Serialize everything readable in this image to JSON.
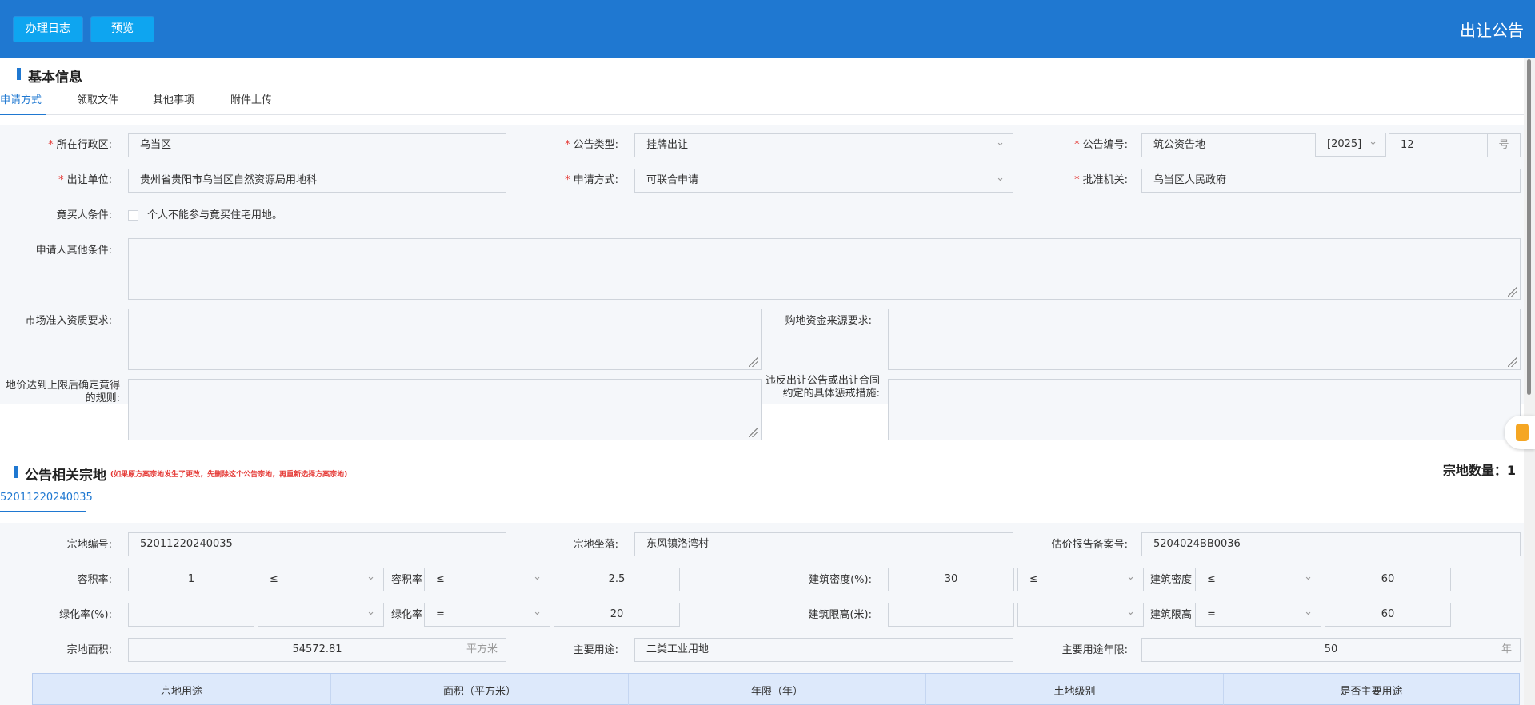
{
  "header": {
    "log_button": "办理日志",
    "preview_button": "预览",
    "title": "出让公告"
  },
  "basic": {
    "title": "基本信息",
    "tabs": [
      "申请方式",
      "领取文件",
      "其他事项",
      "附件上传"
    ],
    "fields": {
      "region_label": "所在行政区:",
      "region_value": "乌当区",
      "notice_type_label": "公告类型:",
      "notice_type_value": "挂牌出让",
      "notice_no_label": "公告编号:",
      "notice_no_prefix": "筑公资告地",
      "notice_no_year": "[2025]",
      "notice_no_number": "12",
      "notice_no_suffix": "号",
      "unit_label": "出让单位:",
      "unit_value": "贵州省贵阳市乌当区自然资源局用地科",
      "apply_method_label": "申请方式:",
      "apply_method_value": "可联合申请",
      "approval_label": "批准机关:",
      "approval_value": "乌当区人民政府",
      "bidder_label": "竟买人条件:",
      "bidder_option": "个人不能参与竟买住宅用地。",
      "other_cond_label": "申请人其他条件:",
      "market_label": "市场准入资质要求:",
      "fund_label": "购地资金来源要求:",
      "price_rule_label": "地价达到上限后确定竟得的规则:",
      "penalty_label": "违反出让公告或出让合同约定的具体惩戒措施:"
    }
  },
  "parcel": {
    "title": "公告相关宗地",
    "note": "(如果原方案宗地发生了更改，先删除这个公告宗地，再重新选择方案宗地)",
    "count_label": "宗地数量：",
    "count_value": "1",
    "tab": "52011220240035",
    "fields": {
      "code_label": "宗地编号:",
      "code_value": "52011220240035",
      "location_label": "宗地坐落:",
      "location_value": "东风镇洛湾村",
      "appraisal_label": "估价报告备案号:",
      "appraisal_value": "5204024BB0036",
      "far_label": "容积率:",
      "far_min": "1",
      "far_op1": "≤",
      "far_mid_label": "容积率",
      "far_op2": "≤",
      "far_max": "2.5",
      "density_label": "建筑密度(%):",
      "density_min": "30",
      "density_op1": "≤",
      "density_mid_label": "建筑密度",
      "density_op2": "≤",
      "density_max": "60",
      "green_label": "绿化率(%):",
      "green_min": "",
      "green_op1": "",
      "green_mid_label": "绿化率",
      "green_op2": "=",
      "green_max": "20",
      "height_label": "建筑限高(米):",
      "height_min": "",
      "height_op1": "",
      "height_mid_label": "建筑限高",
      "height_op2": "=",
      "height_max": "60",
      "area_label": "宗地面积:",
      "area_value": "54572.81",
      "area_unit": "平方米",
      "use_label": "主要用途:",
      "use_value": "二类工业用地",
      "term_label": "主要用途年限:",
      "term_value": "50",
      "term_unit": "年"
    },
    "table_headers": [
      "宗地用途",
      "面积（平方米）",
      "年限（年）",
      "土地级别",
      "是否主要用途"
    ]
  }
}
